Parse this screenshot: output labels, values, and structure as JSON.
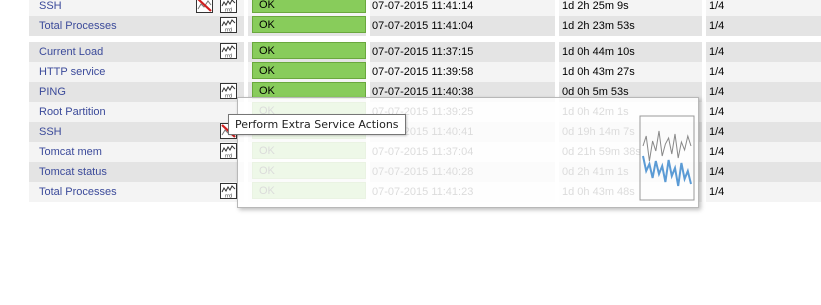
{
  "top_rows": [
    {
      "service": "SSH",
      "status": "OK",
      "last_check": "07-07-2015 11:41:14",
      "duration": "1d 2h 25m 9s",
      "attempt": "1/4",
      "icons": [
        "no-graph-icon",
        "rrd-graph-icon"
      ]
    },
    {
      "service": "Total Processes",
      "status": "OK",
      "last_check": "07-07-2015 11:41:04",
      "duration": "1d 2h 23m 53s",
      "attempt": "1/4",
      "icons": [
        "rrd-graph-icon"
      ]
    }
  ],
  "bottom_rows": [
    {
      "service": "Current Load",
      "status": "OK",
      "last_check": "07-07-2015 11:37:15",
      "duration": "1d 0h 44m 10s",
      "attempt": "1/4",
      "icons": [
        "rrd-graph-icon"
      ]
    },
    {
      "service": "HTTP service",
      "status": "OK",
      "last_check": "07-07-2015 11:39:58",
      "duration": "1d 0h 43m 27s",
      "attempt": "1/4",
      "icons": []
    },
    {
      "service": "PING",
      "status": "OK",
      "last_check": "07-07-2015 11:40:38",
      "duration": "0d 0h 5m 53s",
      "attempt": "1/4",
      "icons": [
        "rrd-graph-icon"
      ]
    },
    {
      "service": "Root Partition",
      "status": "OK",
      "last_check": "07-07-2015 11:39:25",
      "duration": "1d 0h 42m 1s",
      "attempt": "1/4",
      "icons": []
    },
    {
      "service": "SSH",
      "status": "OK",
      "last_check": "07-07-2015 11:40:41",
      "duration": "0d 19h 14m 7s",
      "attempt": "1/4",
      "icons": [
        "no-graph-icon"
      ]
    },
    {
      "service": "Tomcat mem",
      "status": "OK",
      "last_check": "07-07-2015 11:37:04",
      "duration": "0d 21h 59m 38s",
      "attempt": "1/4",
      "icons": [
        "rrd-graph-icon"
      ]
    },
    {
      "service": "Tomcat status",
      "status": "OK",
      "last_check": "07-07-2015 11:40:28",
      "duration": "0d 2h 41m 1s",
      "attempt": "1/4",
      "icons": []
    },
    {
      "service": "Total Processes",
      "status": "OK",
      "last_check": "07-07-2015 11:41:23",
      "duration": "1d 0h 43m 48s",
      "attempt": "1/4",
      "icons": [
        "rrd-graph-icon"
      ]
    }
  ],
  "tooltip": {
    "text": "Perform Extra Service Actions"
  },
  "colors": {
    "status_ok": "#88cc5b",
    "link": "#3b4a9a",
    "row_light": "#f4f4f4",
    "row_dark": "#e4e4e4",
    "graph_line": "#5b9bd5"
  }
}
